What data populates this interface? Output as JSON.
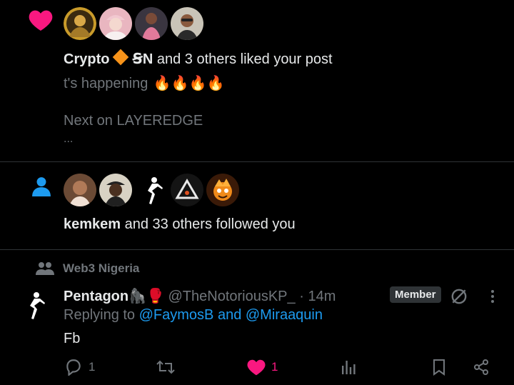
{
  "like_notification": {
    "bold_name": "Crypto",
    "name_suffix": "ꞨN",
    "summary": "and 3 others liked your post",
    "post_preview": "t's happening",
    "post_fire": "🔥🔥🔥🔥",
    "post_next_line": "Next on LAYEREDGE",
    "post_ellipsis": "..."
  },
  "follow_notification": {
    "bold_name": "kemkem",
    "summary": "and 33 others followed you"
  },
  "community_post": {
    "community_name": "Web3 Nigeria",
    "author_name": "Pentagon🦍🥊",
    "handle": "@TheNotoriousKP_",
    "separator": "·",
    "time": "14m",
    "member_badge": "Member",
    "replying_prefix": "Replying to",
    "replying_targets": "@FaymosB and @Miraaquin",
    "body": "Fb",
    "actions": {
      "reply_count": "1",
      "repost_count": "",
      "like_count": "1"
    }
  },
  "colors": {
    "like_pink": "#f91880",
    "follow_blue": "#1d9bf0",
    "muted": "#71767b",
    "border": "#2f3336"
  },
  "icons": {
    "like_type": "heart-icon",
    "follow_type": "person-icon",
    "community": "people-icon",
    "grok": "slash-circle-icon",
    "more": "more-vertical-icon",
    "reply": "reply-icon",
    "repost": "repost-icon",
    "like": "heart-icon",
    "views": "views-icon",
    "bookmark": "bookmark-icon",
    "share": "share-icon"
  }
}
